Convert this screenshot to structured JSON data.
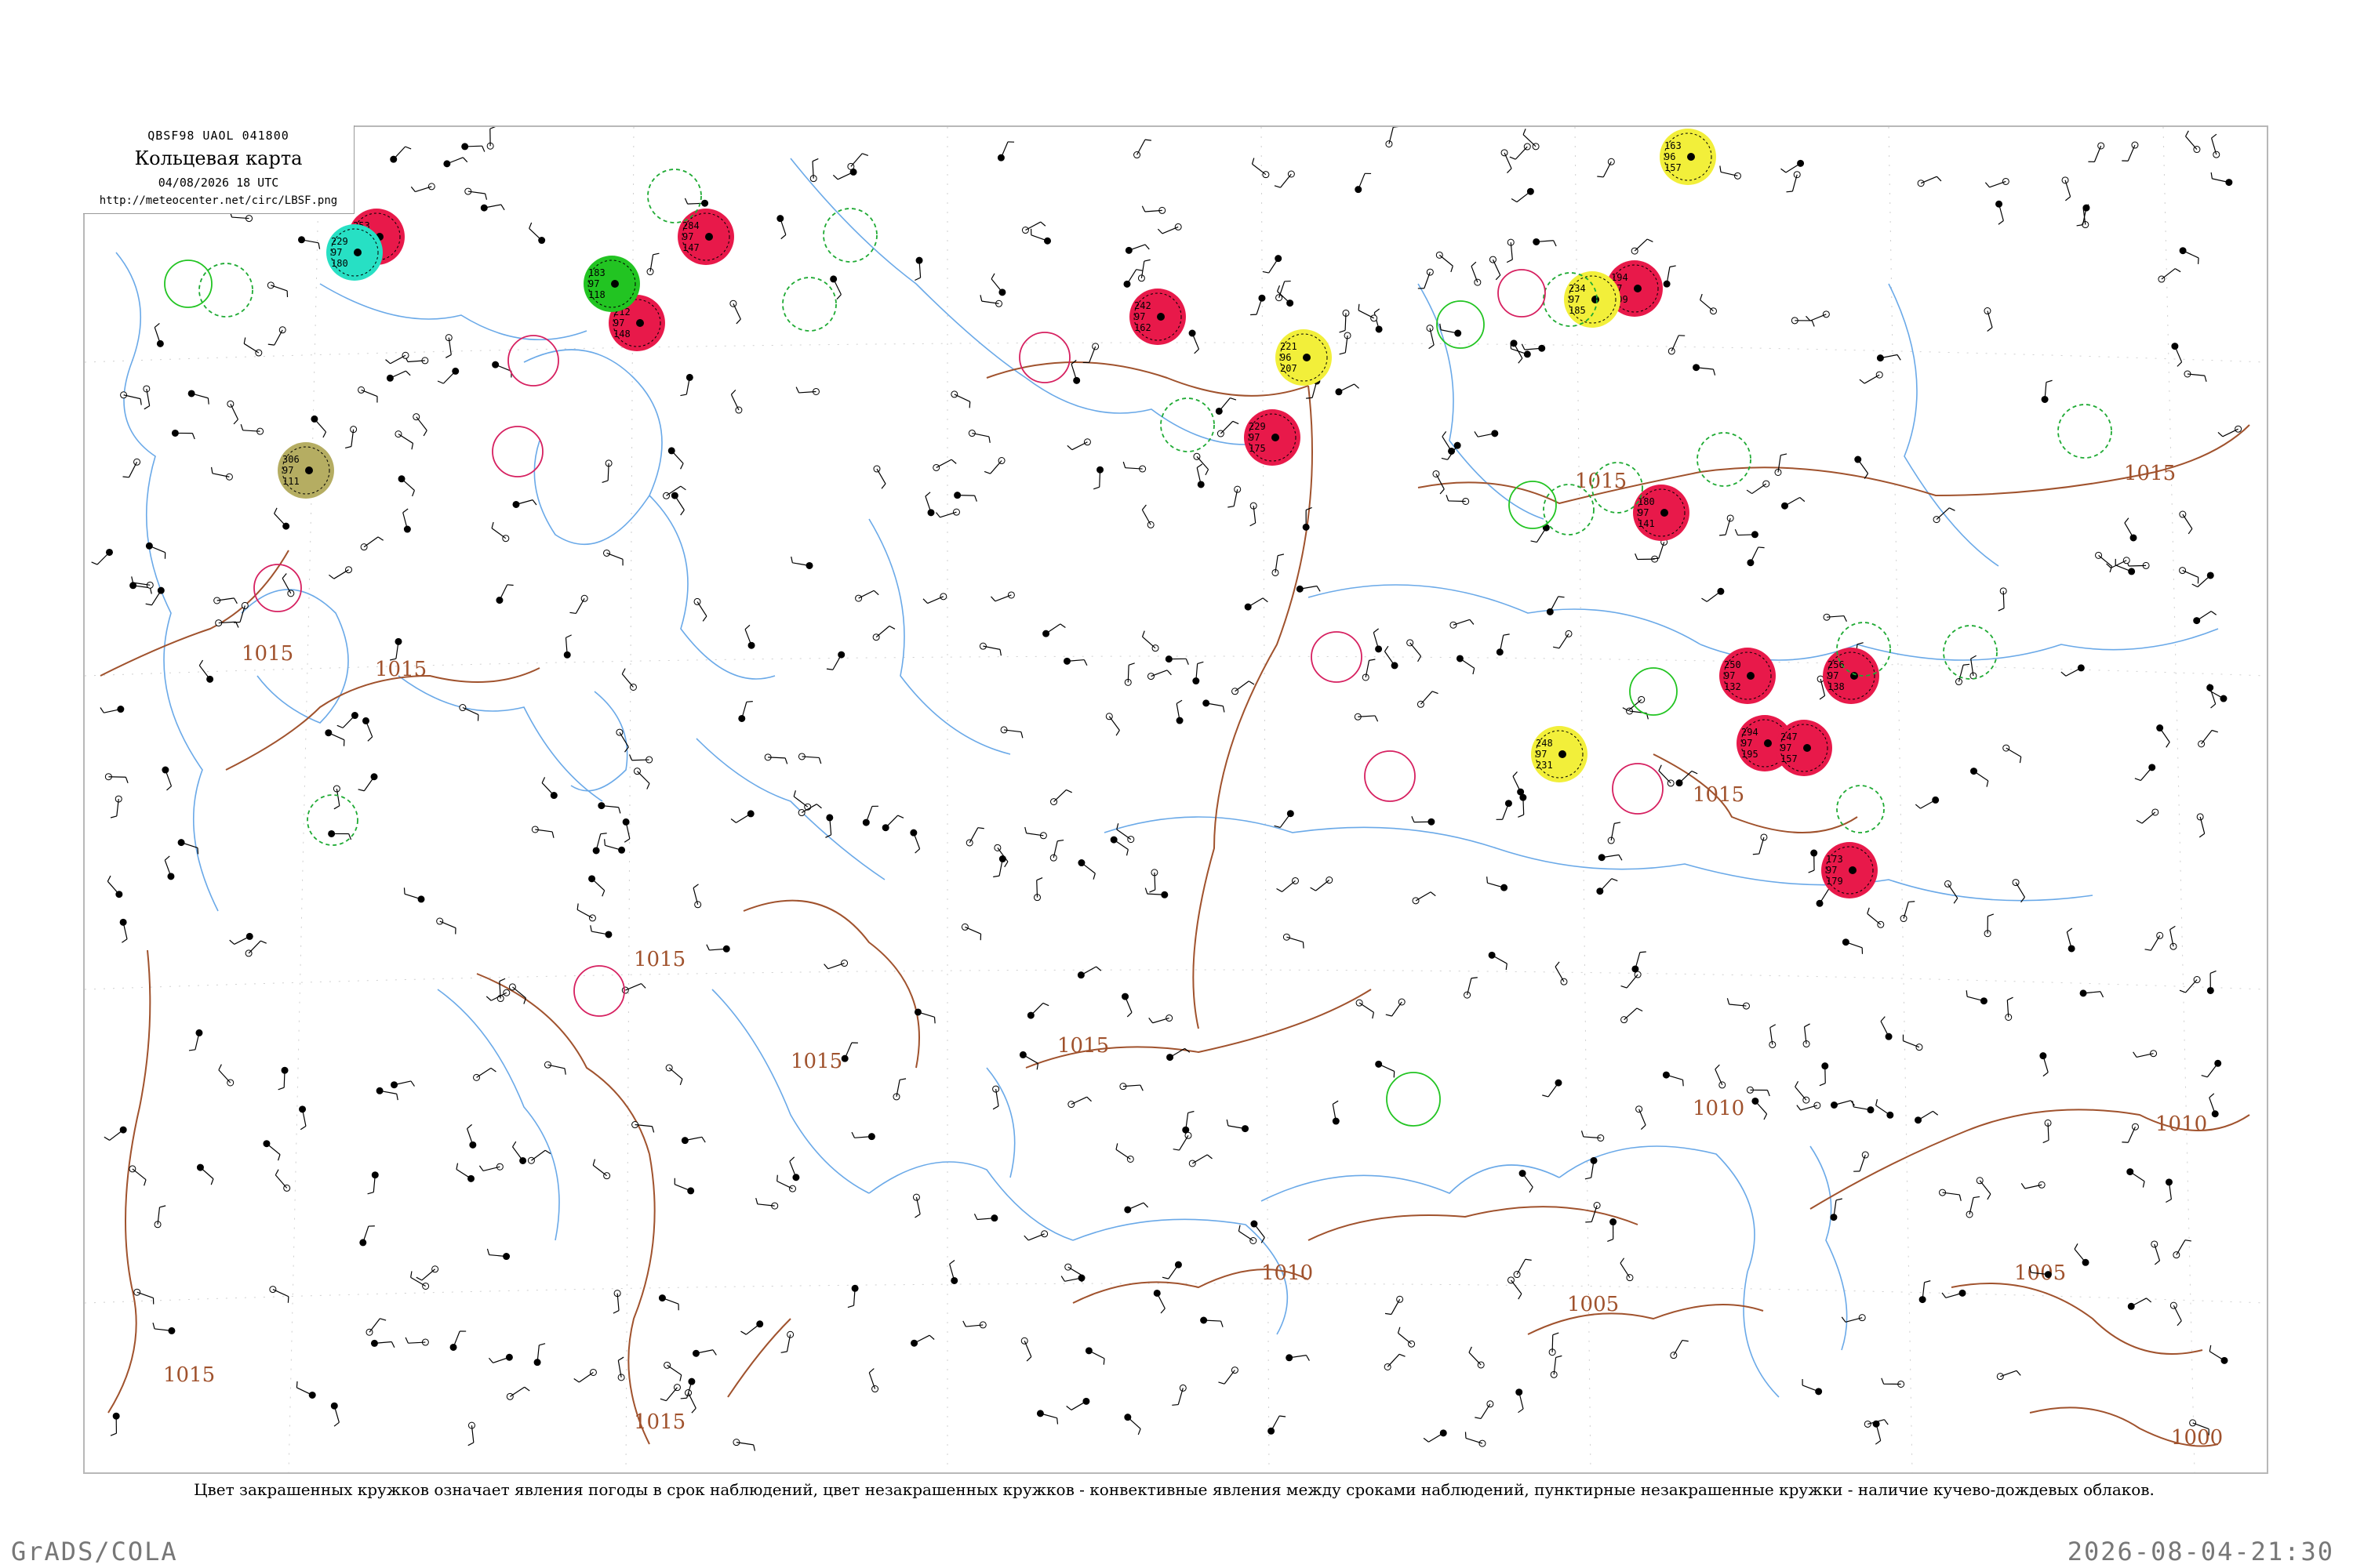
{
  "header": {
    "code_line": "QBSF98  UAOL  041800",
    "title": "Кольцевая карта",
    "datetime": "04/08/2026 18 UTC",
    "url": "http://meteocenter.net/circ/LBSF.png"
  },
  "legend_note": "Цвет закрашенных кружков означает явления погоды в срок наблюдений, цвет незакрашенных кружков - конвективные явления между сроками наблюдений, пунктирные незакрашенные кружки - наличие кучево-дождевых облаков.",
  "footer": {
    "left": "GrADS/COLA",
    "right": "2026-08-04-21:30"
  },
  "colors": {
    "isobar": "#a0522d",
    "coast": "#6aa9e8",
    "thunderstorm": "#e8194a",
    "rain": "#22c422",
    "shower": "#f2ef3a",
    "fog": "#c9b800",
    "snow": "#27e0c4",
    "haze": "#b5ad62",
    "cb_dashed": "#1eaa33",
    "convective_open": "#d62060"
  },
  "isobars": [
    {
      "label": "1015",
      "note": "west coast, south"
    },
    {
      "label": "1015",
      "note": "north-west"
    },
    {
      "label": "1015",
      "note": "central Baltic"
    },
    {
      "label": "1015",
      "note": "central Europe"
    },
    {
      "label": "1015",
      "note": "Balkans"
    },
    {
      "label": "1015",
      "note": "Carpathians"
    },
    {
      "label": "1015",
      "note": "Ukraine"
    },
    {
      "label": "1015",
      "note": "central Russia"
    },
    {
      "label": "1015",
      "note": "Volga"
    },
    {
      "label": "1015",
      "note": "east"
    },
    {
      "label": "1010",
      "note": "Black Sea"
    },
    {
      "label": "1010",
      "note": "Caspian"
    },
    {
      "label": "1010",
      "note": "far east"
    },
    {
      "label": "1005",
      "note": "Caucasus"
    },
    {
      "label": "1005",
      "note": "Kazakhstan"
    },
    {
      "label": "1000",
      "note": "south-east corner"
    }
  ],
  "highlighted_stations": [
    {
      "kind": "thunderstorm",
      "values": [
        "253",
        "97",
        "147"
      ]
    },
    {
      "kind": "thunderstorm",
      "values": [
        "212",
        "97",
        "148"
      ]
    },
    {
      "kind": "thunderstorm",
      "values": [
        "284",
        "97",
        "147"
      ]
    },
    {
      "kind": "thunderstorm",
      "values": [
        "242",
        "97",
        "162"
      ]
    },
    {
      "kind": "thunderstorm",
      "values": [
        "229",
        "97",
        "175"
      ]
    },
    {
      "kind": "thunderstorm",
      "values": [
        "194",
        "97",
        "109"
      ]
    },
    {
      "kind": "thunderstorm",
      "values": [
        "180",
        "97",
        "141"
      ]
    },
    {
      "kind": "thunderstorm",
      "values": [
        "250",
        "97",
        "132"
      ]
    },
    {
      "kind": "thunderstorm",
      "values": [
        "256",
        "97",
        "138"
      ]
    },
    {
      "kind": "thunderstorm",
      "values": [
        "294",
        "97",
        "195"
      ]
    },
    {
      "kind": "thunderstorm",
      "values": [
        "247",
        "97",
        "157"
      ]
    },
    {
      "kind": "thunderstorm",
      "values": [
        "173",
        "97",
        "179"
      ]
    },
    {
      "kind": "rain",
      "values": [
        "183",
        "97",
        "118"
      ]
    },
    {
      "kind": "snow",
      "values": [
        "229",
        "97",
        "180"
      ]
    },
    {
      "kind": "shower",
      "values": [
        "163",
        "96",
        "157"
      ]
    },
    {
      "kind": "shower",
      "values": [
        "221",
        "96",
        "207"
      ]
    },
    {
      "kind": "shower",
      "values": [
        "248",
        "97",
        "231"
      ]
    },
    {
      "kind": "shower",
      "values": [
        "234",
        "97",
        "185"
      ]
    },
    {
      "kind": "haze",
      "values": [
        "306",
        "97",
        "111"
      ]
    }
  ]
}
